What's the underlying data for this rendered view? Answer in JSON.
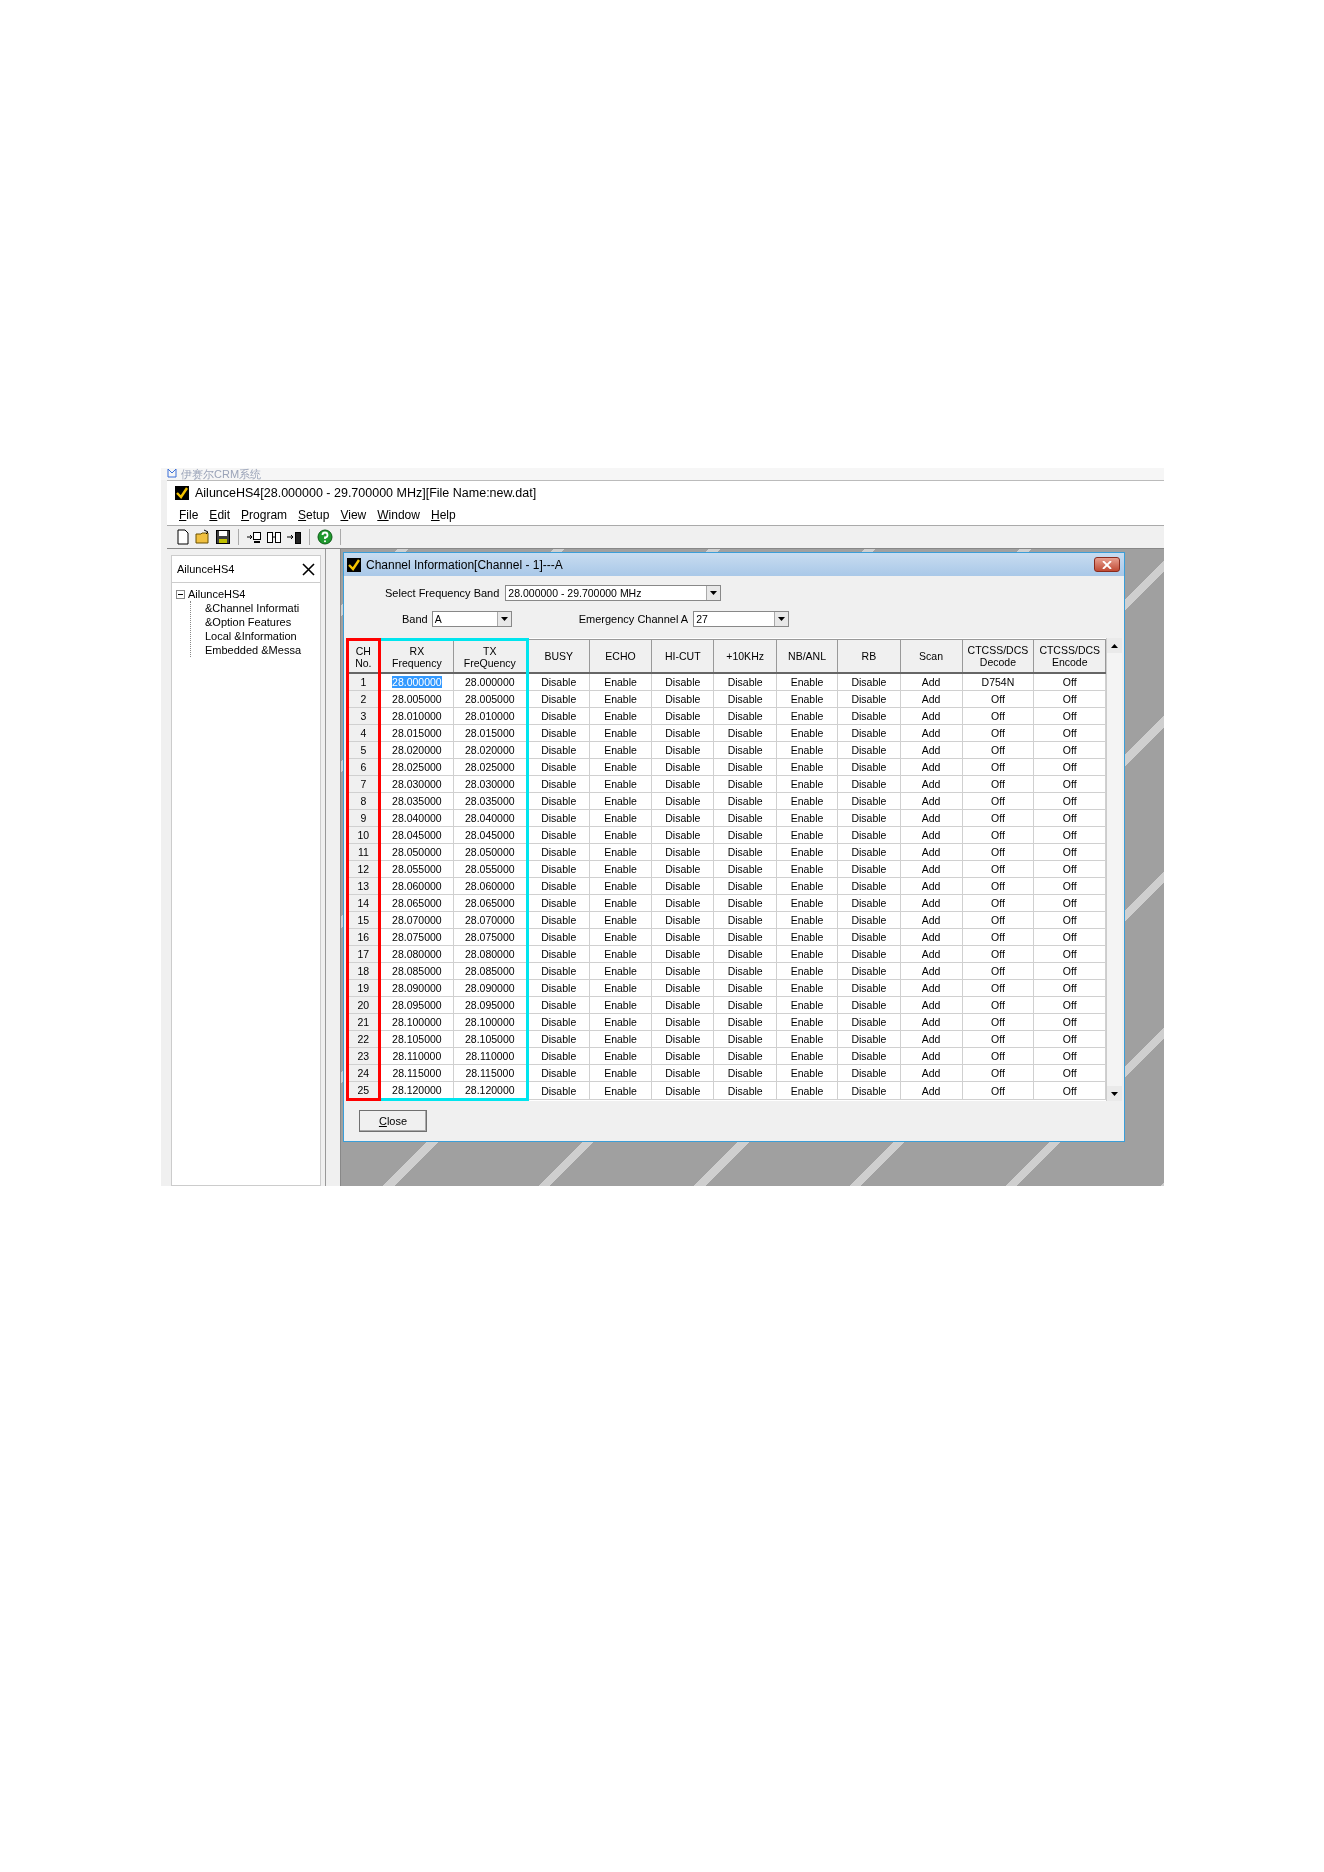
{
  "behind_title": "伊赛尔CRM系统",
  "window": {
    "title": "AilunceHS4[28.000000 - 29.700000 MHz][File Name:new.dat]"
  },
  "menu": [
    "File",
    "Edit",
    "Program",
    "Setup",
    "View",
    "Window",
    "Help"
  ],
  "sidebar": {
    "title": "AilunceHS4",
    "tree": [
      {
        "label": "AilunceHS4",
        "expanded": true,
        "children": [
          {
            "label": "&Channel Informati"
          },
          {
            "label": "&Option Features"
          },
          {
            "label": "Local &Information"
          },
          {
            "label": "Embedded &Messa"
          }
        ]
      }
    ]
  },
  "dialog": {
    "title": "Channel Information[Channel - 1]---A",
    "frequency_band": {
      "label": "Select Frequency Band",
      "value": "28.000000 - 29.700000 MHz"
    },
    "band": {
      "label": "Band",
      "value": "A"
    },
    "emergency_channel": {
      "label": "Emergency Channel A",
      "value": "27"
    },
    "columns": [
      {
        "label": "CH\nNo.",
        "color": "#ff0000"
      },
      {
        "label": "RX\nFrequency",
        "color": "#00e5ee"
      },
      {
        "label": "TX\nFreQuency",
        "color": "#00e5ee"
      },
      {
        "label": "BUSY"
      },
      {
        "label": "ECHO"
      },
      {
        "label": "HI-CUT"
      },
      {
        "label": "+10KHz"
      },
      {
        "label": "NB/ANL"
      },
      {
        "label": "RB"
      },
      {
        "label": "Scan"
      },
      {
        "label": "CTCSS/DCS\nDecode"
      },
      {
        "label": "CTCSS/DCS\nEncode"
      }
    ],
    "rows": [
      {
        "selected": true,
        "cells": [
          "1",
          "28.000000",
          "28.000000",
          "Disable",
          "Enable",
          "Disable",
          "Disable",
          "Enable",
          "Disable",
          "Add",
          "D754N",
          "Off"
        ]
      },
      {
        "selected": false,
        "cells": [
          "2",
          "28.005000",
          "28.005000",
          "Disable",
          "Enable",
          "Disable",
          "Disable",
          "Enable",
          "Disable",
          "Add",
          "Off",
          "Off"
        ]
      },
      {
        "selected": false,
        "cells": [
          "3",
          "28.010000",
          "28.010000",
          "Disable",
          "Enable",
          "Disable",
          "Disable",
          "Enable",
          "Disable",
          "Add",
          "Off",
          "Off"
        ]
      },
      {
        "selected": false,
        "cells": [
          "4",
          "28.015000",
          "28.015000",
          "Disable",
          "Enable",
          "Disable",
          "Disable",
          "Enable",
          "Disable",
          "Add",
          "Off",
          "Off"
        ]
      },
      {
        "selected": false,
        "cells": [
          "5",
          "28.020000",
          "28.020000",
          "Disable",
          "Enable",
          "Disable",
          "Disable",
          "Enable",
          "Disable",
          "Add",
          "Off",
          "Off"
        ]
      },
      {
        "selected": false,
        "cells": [
          "6",
          "28.025000",
          "28.025000",
          "Disable",
          "Enable",
          "Disable",
          "Disable",
          "Enable",
          "Disable",
          "Add",
          "Off",
          "Off"
        ]
      },
      {
        "selected": false,
        "cells": [
          "7",
          "28.030000",
          "28.030000",
          "Disable",
          "Enable",
          "Disable",
          "Disable",
          "Enable",
          "Disable",
          "Add",
          "Off",
          "Off"
        ]
      },
      {
        "selected": false,
        "cells": [
          "8",
          "28.035000",
          "28.035000",
          "Disable",
          "Enable",
          "Disable",
          "Disable",
          "Enable",
          "Disable",
          "Add",
          "Off",
          "Off"
        ]
      },
      {
        "selected": false,
        "cells": [
          "9",
          "28.040000",
          "28.040000",
          "Disable",
          "Enable",
          "Disable",
          "Disable",
          "Enable",
          "Disable",
          "Add",
          "Off",
          "Off"
        ]
      },
      {
        "selected": false,
        "cells": [
          "10",
          "28.045000",
          "28.045000",
          "Disable",
          "Enable",
          "Disable",
          "Disable",
          "Enable",
          "Disable",
          "Add",
          "Off",
          "Off"
        ]
      },
      {
        "selected": false,
        "cells": [
          "11",
          "28.050000",
          "28.050000",
          "Disable",
          "Enable",
          "Disable",
          "Disable",
          "Enable",
          "Disable",
          "Add",
          "Off",
          "Off"
        ]
      },
      {
        "selected": false,
        "cells": [
          "12",
          "28.055000",
          "28.055000",
          "Disable",
          "Enable",
          "Disable",
          "Disable",
          "Enable",
          "Disable",
          "Add",
          "Off",
          "Off"
        ]
      },
      {
        "selected": false,
        "cells": [
          "13",
          "28.060000",
          "28.060000",
          "Disable",
          "Enable",
          "Disable",
          "Disable",
          "Enable",
          "Disable",
          "Add",
          "Off",
          "Off"
        ]
      },
      {
        "selected": false,
        "cells": [
          "14",
          "28.065000",
          "28.065000",
          "Disable",
          "Enable",
          "Disable",
          "Disable",
          "Enable",
          "Disable",
          "Add",
          "Off",
          "Off"
        ]
      },
      {
        "selected": false,
        "cells": [
          "15",
          "28.070000",
          "28.070000",
          "Disable",
          "Enable",
          "Disable",
          "Disable",
          "Enable",
          "Disable",
          "Add",
          "Off",
          "Off"
        ]
      },
      {
        "selected": false,
        "cells": [
          "16",
          "28.075000",
          "28.075000",
          "Disable",
          "Enable",
          "Disable",
          "Disable",
          "Enable",
          "Disable",
          "Add",
          "Off",
          "Off"
        ]
      },
      {
        "selected": false,
        "cells": [
          "17",
          "28.080000",
          "28.080000",
          "Disable",
          "Enable",
          "Disable",
          "Disable",
          "Enable",
          "Disable",
          "Add",
          "Off",
          "Off"
        ]
      },
      {
        "selected": false,
        "cells": [
          "18",
          "28.085000",
          "28.085000",
          "Disable",
          "Enable",
          "Disable",
          "Disable",
          "Enable",
          "Disable",
          "Add",
          "Off",
          "Off"
        ]
      },
      {
        "selected": false,
        "cells": [
          "19",
          "28.090000",
          "28.090000",
          "Disable",
          "Enable",
          "Disable",
          "Disable",
          "Enable",
          "Disable",
          "Add",
          "Off",
          "Off"
        ]
      },
      {
        "selected": false,
        "cells": [
          "20",
          "28.095000",
          "28.095000",
          "Disable",
          "Enable",
          "Disable",
          "Disable",
          "Enable",
          "Disable",
          "Add",
          "Off",
          "Off"
        ]
      },
      {
        "selected": false,
        "cells": [
          "21",
          "28.100000",
          "28.100000",
          "Disable",
          "Enable",
          "Disable",
          "Disable",
          "Enable",
          "Disable",
          "Add",
          "Off",
          "Off"
        ]
      },
      {
        "selected": false,
        "cells": [
          "22",
          "28.105000",
          "28.105000",
          "Disable",
          "Enable",
          "Disable",
          "Disable",
          "Enable",
          "Disable",
          "Add",
          "Off",
          "Off"
        ]
      },
      {
        "selected": false,
        "cells": [
          "23",
          "28.110000",
          "28.110000",
          "Disable",
          "Enable",
          "Disable",
          "Disable",
          "Enable",
          "Disable",
          "Add",
          "Off",
          "Off"
        ]
      },
      {
        "selected": false,
        "cells": [
          "24",
          "28.115000",
          "28.115000",
          "Disable",
          "Enable",
          "Disable",
          "Disable",
          "Enable",
          "Disable",
          "Add",
          "Off",
          "Off"
        ]
      },
      {
        "selected": false,
        "cells": [
          "25",
          "28.120000",
          "28.120000",
          "Disable",
          "Enable",
          "Disable",
          "Disable",
          "Enable",
          "Disable",
          "Add",
          "Off",
          "Off"
        ]
      }
    ],
    "close_button": "Close"
  }
}
